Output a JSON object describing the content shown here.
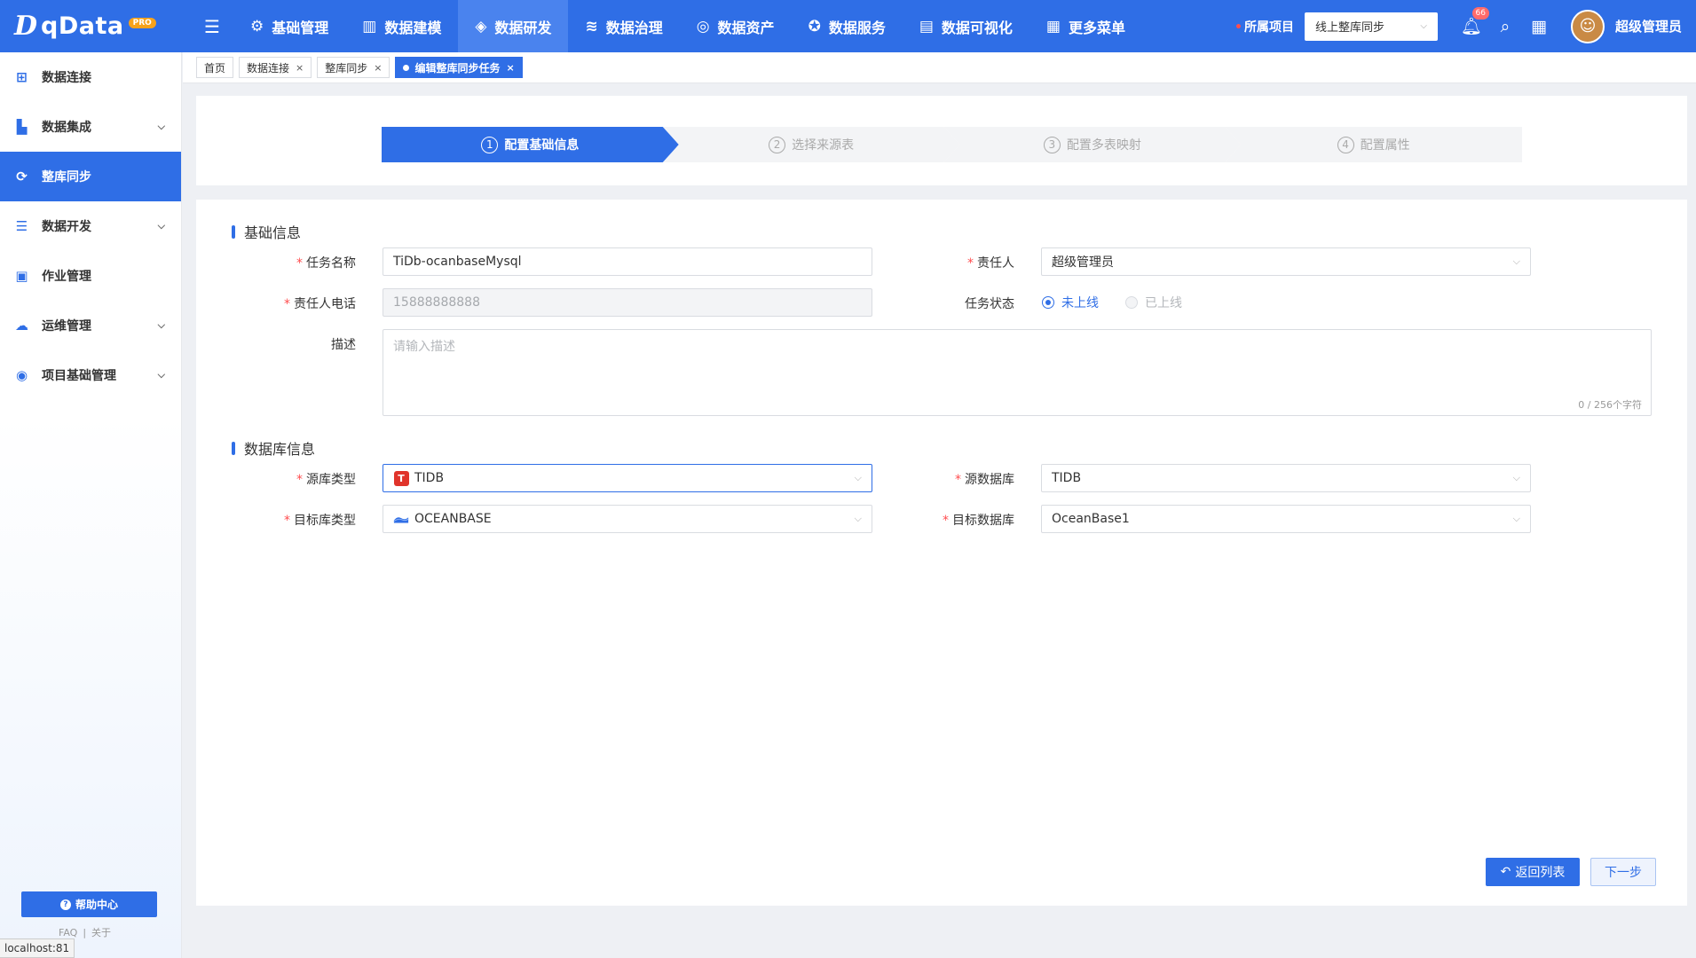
{
  "header": {
    "logo_text": "qData",
    "logo_badge": "PRO",
    "nav": [
      {
        "label": "基础管理",
        "icon": "gear-cube-icon"
      },
      {
        "label": "数据建模",
        "icon": "book-icon"
      },
      {
        "label": "数据研发",
        "icon": "cube-icon"
      },
      {
        "label": "数据治理",
        "icon": "database-stack-icon"
      },
      {
        "label": "数据资产",
        "icon": "target-icon"
      },
      {
        "label": "数据服务",
        "icon": "service-icon"
      },
      {
        "label": "数据可视化",
        "icon": "chart-icon"
      },
      {
        "label": "更多菜单",
        "icon": "grid-plus-icon"
      }
    ],
    "active_nav": 2,
    "project_label": "所属项目",
    "project_value": "线上整库同步",
    "notification_count": "66",
    "user_name": "超级管理员"
  },
  "sidebar": {
    "items": [
      {
        "label": "数据连接",
        "expandable": false
      },
      {
        "label": "数据集成",
        "expandable": true
      },
      {
        "label": "整库同步",
        "expandable": false
      },
      {
        "label": "数据开发",
        "expandable": true
      },
      {
        "label": "作业管理",
        "expandable": false
      },
      {
        "label": "运维管理",
        "expandable": true
      },
      {
        "label": "项目基础管理",
        "expandable": true
      }
    ],
    "active_index": 2,
    "help_label": "帮助中心",
    "footer_links": [
      "FAQ",
      "关于"
    ]
  },
  "status_bar": {
    "url": "localhost:81"
  },
  "tabs": [
    {
      "label": "首页",
      "closable": false,
      "active": false
    },
    {
      "label": "数据连接",
      "closable": true,
      "active": false
    },
    {
      "label": "整库同步",
      "closable": true,
      "active": false
    },
    {
      "label": "编辑整库同步任务",
      "closable": true,
      "active": true
    }
  ],
  "steps": [
    {
      "num": "1",
      "label": "配置基础信息",
      "active": true
    },
    {
      "num": "2",
      "label": "选择来源表",
      "active": false
    },
    {
      "num": "3",
      "label": "配置多表映射",
      "active": false
    },
    {
      "num": "4",
      "label": "配置属性",
      "active": false
    }
  ],
  "basic_info": {
    "title": "基础信息",
    "task_name_label": "任务名称",
    "task_name_value": "TiDb-ocanbaseMysql",
    "owner_label": "责任人",
    "owner_value": "超级管理员",
    "phone_label": "责任人电话",
    "phone_value": "15888888888",
    "status_label": "任务状态",
    "status_options": [
      "未上线",
      "已上线"
    ],
    "status_selected": "未上线",
    "desc_label": "描述",
    "desc_placeholder": "请输入描述",
    "desc_counter": "0 / 256个字符"
  },
  "db_info": {
    "title": "数据库信息",
    "source_type_label": "源库类型",
    "source_type_value": "TIDB",
    "source_db_label": "源数据库",
    "source_db_value": "TIDB",
    "target_type_label": "目标库类型",
    "target_type_value": "OCEANBASE",
    "target_db_label": "目标数据库",
    "target_db_value": "OceanBase1"
  },
  "actions": {
    "back_label": "返回列表",
    "next_label": "下一步"
  },
  "colors": {
    "primary": "#2f6ee6",
    "required": "#ff4d4f",
    "tidb": "#e0342b"
  }
}
